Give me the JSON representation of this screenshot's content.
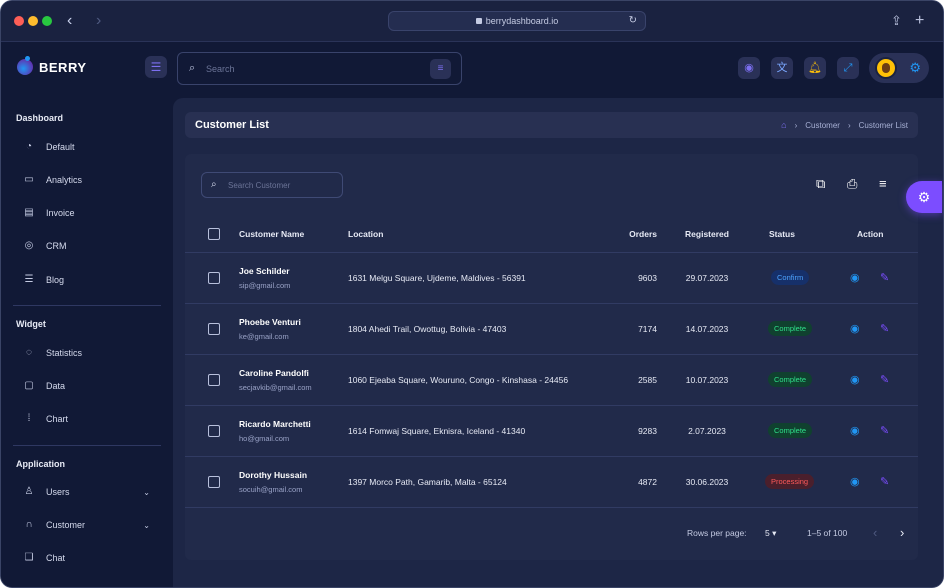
{
  "browser": {
    "url": "berrydashboard.io",
    "back_icon": "‹",
    "forward_icon": "›"
  },
  "brand": {
    "name": "BERRY"
  },
  "header": {
    "search_placeholder": "Search"
  },
  "sidebar": {
    "groups": [
      {
        "title": "Dashboard",
        "items": [
          {
            "label": "Default",
            "icon": "speedometer-icon"
          },
          {
            "label": "Analytics",
            "icon": "device-analytics-icon"
          },
          {
            "label": "Invoice",
            "icon": "invoice-icon"
          },
          {
            "label": "CRM",
            "icon": "crm-icon"
          },
          {
            "label": "Blog",
            "icon": "blog-icon"
          }
        ]
      },
      {
        "title": "Widget",
        "items": [
          {
            "label": "Statistics",
            "icon": "statistics-icon"
          },
          {
            "label": "Data",
            "icon": "clipboard-icon"
          },
          {
            "label": "Chart",
            "icon": "chart-icon"
          }
        ]
      },
      {
        "title": "Application",
        "items": [
          {
            "label": "Users",
            "icon": "user-icon"
          },
          {
            "label": "Customer",
            "icon": "headset-icon"
          },
          {
            "label": "Chat",
            "icon": "chat-icon"
          }
        ]
      }
    ]
  },
  "page": {
    "title": "Customer List",
    "breadcrumb": [
      "Customer",
      "Customer List"
    ]
  },
  "table": {
    "search_placeholder": "Search Customer",
    "columns": [
      "Customer Name",
      "Location",
      "Orders",
      "Registered",
      "Status",
      "Action"
    ],
    "rows": [
      {
        "name": "Joe Schilder",
        "email": "sip@gmail.com",
        "location": "1631 Melgu Square, Ujdeme, Maldives - 56391",
        "orders": "9603",
        "registered": "29.07.2023",
        "status": "Confirm"
      },
      {
        "name": "Phoebe Venturi",
        "email": "ke@gmail.com",
        "location": "1804 Ahedi Trail, Owottug, Bolivia - 47403",
        "orders": "7174",
        "registered": "14.07.2023",
        "status": "Complete"
      },
      {
        "name": "Caroline Pandolfi",
        "email": "secjavkib@gmail.com",
        "location": "1060 Ejeaba Square, Wouruno, Congo - Kinshasa - 24456",
        "orders": "2585",
        "registered": "10.07.2023",
        "status": "Complete"
      },
      {
        "name": "Ricardo Marchetti",
        "email": "ho@gmail.com",
        "location": "1614 Fomwaj Square, Eknisra, Iceland - 41340",
        "orders": "9283",
        "registered": "2.07.2023",
        "status": "Complete"
      },
      {
        "name": "Dorothy Hussain",
        "email": "socuih@gmail.com",
        "location": "1397 Morco Path, Gamarib, Malta - 65124",
        "orders": "4872",
        "registered": "30.06.2023",
        "status": "Processing"
      }
    ],
    "pagination": {
      "rows_per_page_label": "Rows per page:",
      "rows_per_page": "5",
      "range": "1–5 of 100"
    }
  },
  "colors": {
    "accent": "#7c4dff",
    "primary": "#2196f3",
    "confirm": "#4da3ff",
    "complete": "#2fe08a",
    "processing": "#ff5a5a"
  }
}
